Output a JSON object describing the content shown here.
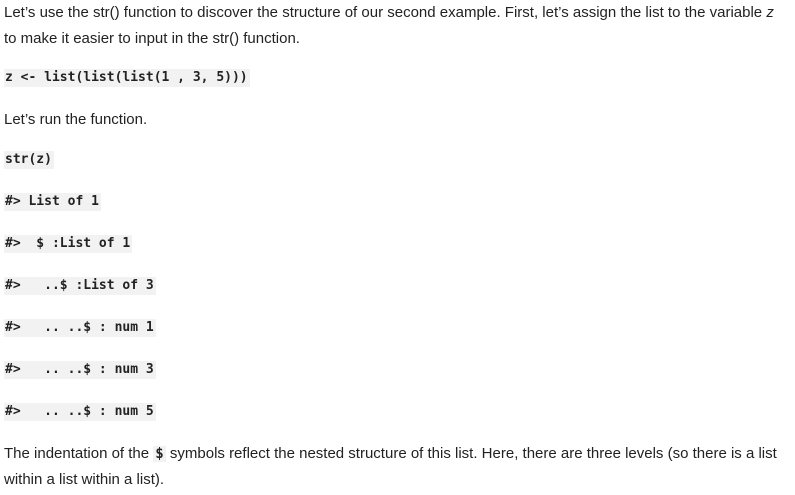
{
  "intro": {
    "part1": "Let’s use the str() function to discover the structure of our second example.  First, let’s assign the list to the variable ",
    "var": "z",
    "part2": " to make it easier to input in the str() function."
  },
  "code_assign": "z <- list(list(list(1 , 3, 5)))",
  "run_text": "Let’s run the function.",
  "code_call": "str(z)",
  "output_lines": [
    "#> List of 1",
    "#>  $ :List of 1",
    "#>   ..$ :List of 3",
    "#>   .. ..$ : num 1",
    "#>   .. ..$ : num 3",
    "#>   .. ..$ : num 5"
  ],
  "conclusion": {
    "part1": "The indentation of the ",
    "symbol": "$",
    "part2": " symbols reflect the nested structure of this list. Here, there are three levels (so there is a list within a list within a list)."
  }
}
